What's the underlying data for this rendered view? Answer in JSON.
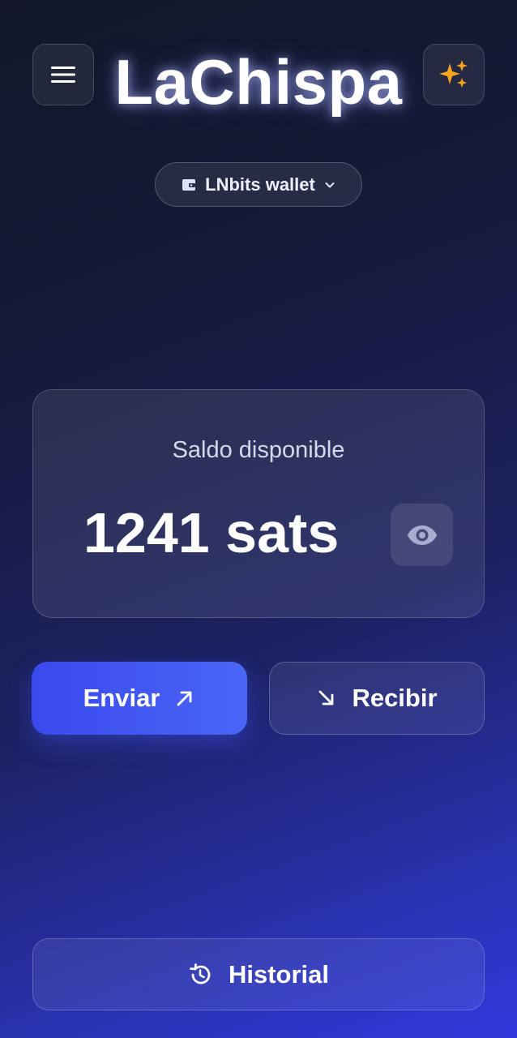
{
  "header": {
    "title": "LaChispa",
    "menu_icon": "hamburger-menu-icon",
    "sparkle_icon": "sparkles-icon",
    "accent_color": "#f7a51c"
  },
  "wallet_selector": {
    "label": "LNbits wallet",
    "icon": "wallet-icon",
    "dropdown_icon": "chevron-down-icon"
  },
  "balance": {
    "caption": "Saldo disponible",
    "amount": "1241 sats",
    "visibility_icon": "eye-icon"
  },
  "actions": {
    "send_label": "Enviar",
    "send_icon": "arrow-up-right-icon",
    "receive_label": "Recibir",
    "receive_icon": "arrow-down-right-icon",
    "primary_color": "#3d4ef0"
  },
  "history": {
    "label": "Historial",
    "icon": "history-icon"
  }
}
